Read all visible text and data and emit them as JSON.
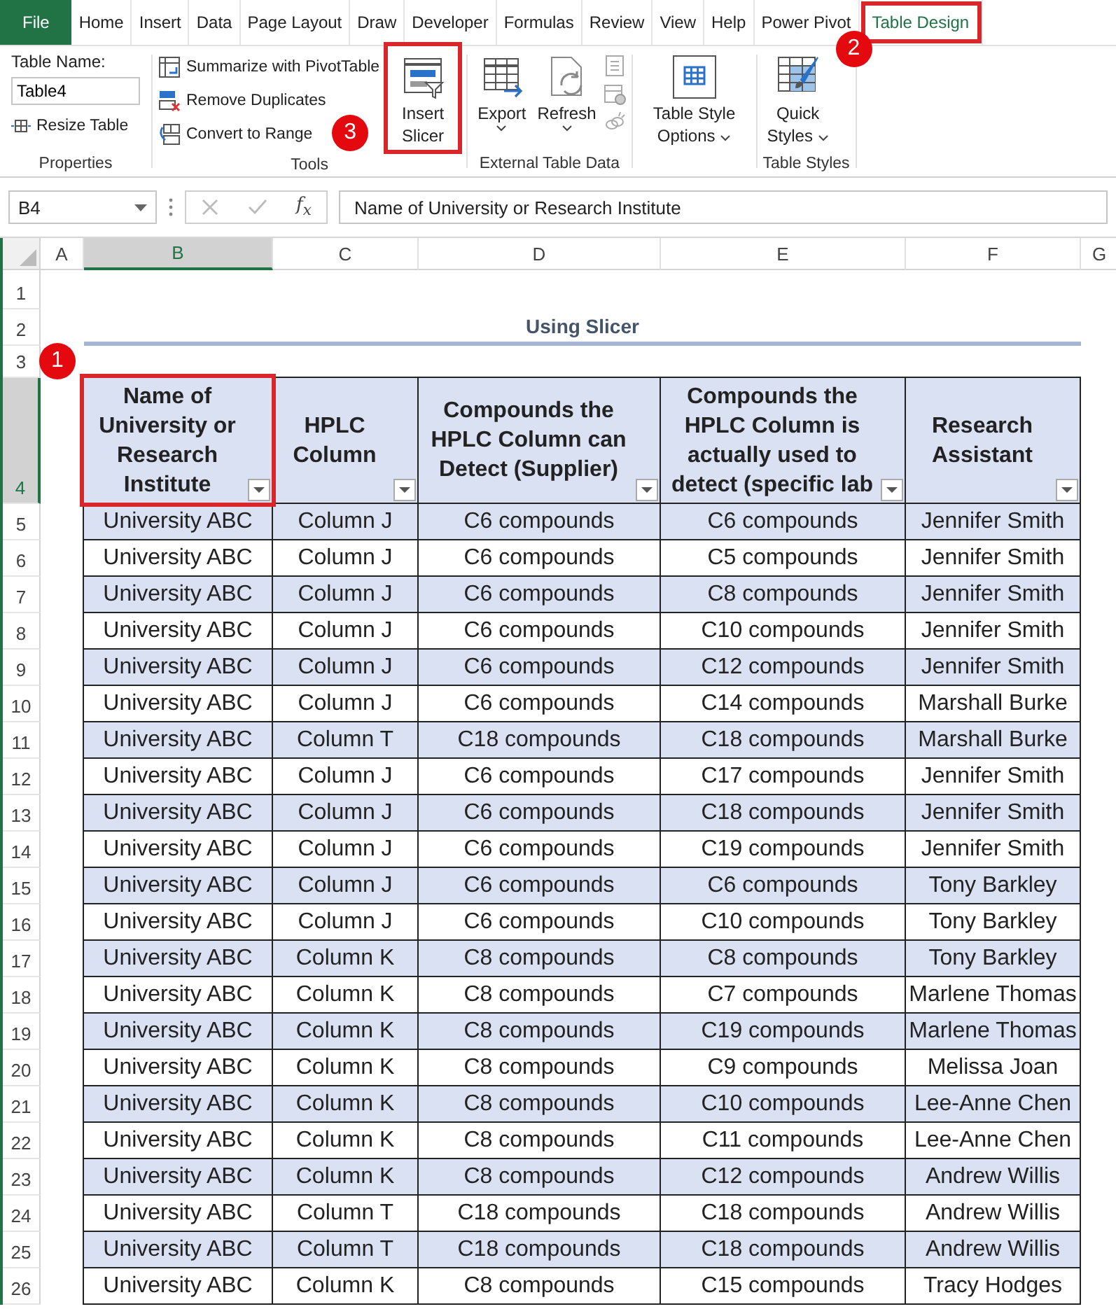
{
  "ribbon_tabs": [
    {
      "label": "File",
      "kind": "file"
    },
    {
      "label": "Home",
      "kind": "tab",
      "selected": false
    },
    {
      "label": "Insert",
      "kind": "tab",
      "selected": false
    },
    {
      "label": "Data",
      "kind": "tab",
      "selected": false
    },
    {
      "label": "Page Layout",
      "kind": "tab",
      "selected": false
    },
    {
      "label": "Draw",
      "kind": "tab",
      "selected": false
    },
    {
      "label": "Developer",
      "kind": "tab",
      "selected": false
    },
    {
      "label": "Formulas",
      "kind": "tab",
      "selected": false
    },
    {
      "label": "Review",
      "kind": "tab",
      "selected": false
    },
    {
      "label": "View",
      "kind": "tab",
      "selected": false
    },
    {
      "label": "Help",
      "kind": "tab",
      "selected": false
    },
    {
      "label": "Power Pivot",
      "kind": "tab",
      "selected": false
    },
    {
      "label": "Table Design",
      "kind": "tab",
      "selected": true,
      "highlighted": true,
      "callout": "2"
    }
  ],
  "ribbon": {
    "properties": {
      "table_name_label": "Table Name:",
      "table_name": "Table4",
      "resize": "Resize Table",
      "group_label": "Properties"
    },
    "tools": {
      "summarize": "Summarize with PivotTable",
      "remove_duplicates": "Remove Duplicates",
      "convert": "Convert to Range",
      "insert_slicer": {
        "label": "Insert Slicer",
        "highlighted": true,
        "callout": "3"
      },
      "group_label": "Tools"
    },
    "external": {
      "export": "Export",
      "refresh": "Refresh",
      "group_label": "External Table Data"
    },
    "style_options": {
      "label": "Table Style Options"
    },
    "table_styles": {
      "quick_styles": "Quick Styles",
      "group_label": "Table Styles"
    }
  },
  "formula_bar": {
    "name_box": "B4",
    "fx": "f$_{x}$",
    "formula": "Name of University or Research Institute"
  },
  "columns": [
    {
      "label": "A",
      "selected": false
    },
    {
      "label": "B",
      "selected": true
    },
    {
      "label": "C",
      "selected": false
    },
    {
      "label": "D",
      "selected": false
    },
    {
      "label": "E",
      "selected": false
    },
    {
      "label": "F",
      "selected": false
    },
    {
      "label": "G",
      "selected": false
    }
  ],
  "row_numbers": [
    {
      "label": "1",
      "selected": false
    },
    {
      "label": "2",
      "selected": false
    },
    {
      "label": "3",
      "selected": false
    },
    {
      "label": "4",
      "selected": true
    },
    {
      "label": "5",
      "selected": false
    },
    {
      "label": "6",
      "selected": false
    },
    {
      "label": "7",
      "selected": false
    },
    {
      "label": "8",
      "selected": false
    },
    {
      "label": "9",
      "selected": false
    },
    {
      "label": "10",
      "selected": false
    },
    {
      "label": "11",
      "selected": false
    },
    {
      "label": "12",
      "selected": false
    },
    {
      "label": "13",
      "selected": false
    },
    {
      "label": "14",
      "selected": false
    },
    {
      "label": "15",
      "selected": false
    },
    {
      "label": "16",
      "selected": false
    },
    {
      "label": "17",
      "selected": false
    },
    {
      "label": "18",
      "selected": false
    },
    {
      "label": "19",
      "selected": false
    },
    {
      "label": "20",
      "selected": false
    },
    {
      "label": "21",
      "selected": false
    },
    {
      "label": "22",
      "selected": false
    },
    {
      "label": "23",
      "selected": false
    },
    {
      "label": "24",
      "selected": false
    },
    {
      "label": "25",
      "selected": false
    },
    {
      "label": "26",
      "selected": false
    }
  ],
  "sheet": {
    "title": "Using Slicer",
    "table": {
      "headers": [
        {
          "label": "Name of University or Research Institute",
          "highlighted": true,
          "callout": "1"
        },
        {
          "label": "HPLC Column",
          "highlighted": false
        },
        {
          "label": "Compounds the HPLC Column can Detect (Supplier)",
          "highlighted": false
        },
        {
          "label": "Compounds the HPLC Column is actually used to detect (specific lab",
          "highlighted": false
        },
        {
          "label": "Research Assistant",
          "highlighted": false
        }
      ],
      "rows": [
        [
          "University ABC",
          "Column J",
          "C6 compounds",
          "C6 compounds",
          "Jennifer Smith"
        ],
        [
          "University ABC",
          "Column J",
          "C6 compounds",
          "C5 compounds",
          "Jennifer Smith"
        ],
        [
          "University ABC",
          "Column J",
          "C6 compounds",
          "C8 compounds",
          "Jennifer Smith"
        ],
        [
          "University ABC",
          "Column J",
          "C6 compounds",
          "C10 compounds",
          "Jennifer Smith"
        ],
        [
          "University ABC",
          "Column J",
          "C6 compounds",
          "C12 compounds",
          "Jennifer Smith"
        ],
        [
          "University ABC",
          "Column J",
          "C6 compounds",
          "C14 compounds",
          "Marshall Burke"
        ],
        [
          "University ABC",
          "Column T",
          "C18 compounds",
          "C18 compounds",
          "Marshall Burke"
        ],
        [
          "University ABC",
          "Column J",
          "C6 compounds",
          "C17 compounds",
          "Jennifer Smith"
        ],
        [
          "University ABC",
          "Column J",
          "C6 compounds",
          "C18 compounds",
          "Jennifer Smith"
        ],
        [
          "University ABC",
          "Column J",
          "C6 compounds",
          "C19 compounds",
          "Jennifer Smith"
        ],
        [
          "University ABC",
          "Column J",
          "C6 compounds",
          "C6 compounds",
          "Tony Barkley"
        ],
        [
          "University ABC",
          "Column J",
          "C6 compounds",
          "C10 compounds",
          "Tony Barkley"
        ],
        [
          "University ABC",
          "Column K",
          "C8 compounds",
          "C8 compounds",
          "Tony Barkley"
        ],
        [
          "University ABC",
          "Column K",
          "C8 compounds",
          "C7 compounds",
          "Marlene Thomas"
        ],
        [
          "University ABC",
          "Column K",
          "C8 compounds",
          "C19 compounds",
          "Marlene Thomas"
        ],
        [
          "University ABC",
          "Column K",
          "C8 compounds",
          "C9 compounds",
          "Melissa Joan"
        ],
        [
          "University ABC",
          "Column K",
          "C8 compounds",
          "C10 compounds",
          "Lee-Anne Chen"
        ],
        [
          "University ABC",
          "Column K",
          "C8 compounds",
          "C11 compounds",
          "Lee-Anne Chen"
        ],
        [
          "University ABC",
          "Column K",
          "C8 compounds",
          "C12 compounds",
          "Andrew Willis"
        ],
        [
          "University ABC",
          "Column T",
          "C18 compounds",
          "C18 compounds",
          "Andrew Willis"
        ],
        [
          "University ABC",
          "Column T",
          "C18 compounds",
          "C18 compounds",
          "Andrew Willis"
        ],
        [
          "University ABC",
          "Column K",
          "C8 compounds",
          "C15 compounds",
          "Tracy Hodges"
        ]
      ]
    }
  }
}
